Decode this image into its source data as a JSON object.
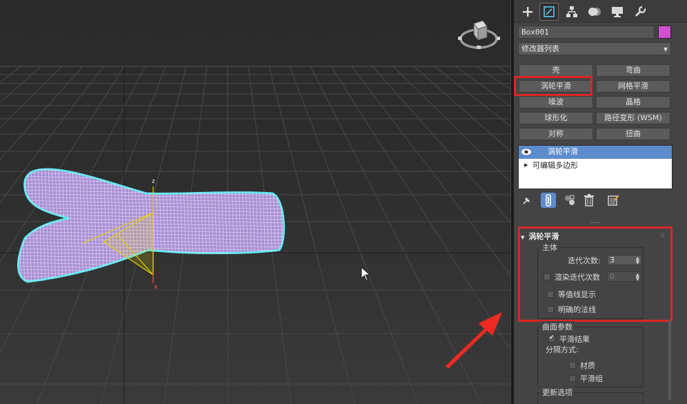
{
  "viewport": {
    "axis_z": "z",
    "axis_x": "x"
  },
  "panel": {
    "tabs": [
      {
        "icon": "plus-icon",
        "label": "Create"
      },
      {
        "icon": "modify-icon",
        "label": "Modify"
      },
      {
        "icon": "hierarchy-icon",
        "label": "Hierarchy"
      },
      {
        "icon": "motion-icon",
        "label": "Motion"
      },
      {
        "icon": "display-icon",
        "label": "Display"
      },
      {
        "icon": "utilities-icon",
        "label": "Utilities"
      }
    ],
    "object_name": "Box001",
    "object_color": "#d14fd0",
    "modifier_list": "修改器列表",
    "modifier_buttons": [
      "壳",
      "弯曲",
      "涡轮平滑",
      "网格平滑",
      "噪波",
      "晶格",
      "球形化",
      "路径变形 (WSM)",
      "对称",
      "扭曲"
    ],
    "stack": {
      "item_1": "涡轮平滑",
      "item_2": "可编辑多边形"
    },
    "rollout": {
      "title": "涡轮平滑",
      "main_group": "主体",
      "iterations_label": "迭代次数:",
      "iterations_value": "3",
      "render_iters_label": "渲染迭代次数",
      "render_iters_value": "0",
      "isoline_label": "等值线显示",
      "explicit_normals_label": "明确的法线",
      "surface_group": "曲面参数",
      "smooth_result_label": "平滑结果",
      "separate_by_label": "分隔方式:",
      "materials_label": "材质",
      "smoothing_groups_label": "平滑组",
      "update_group": "更新选项"
    },
    "highlight_color": "#e02424"
  }
}
